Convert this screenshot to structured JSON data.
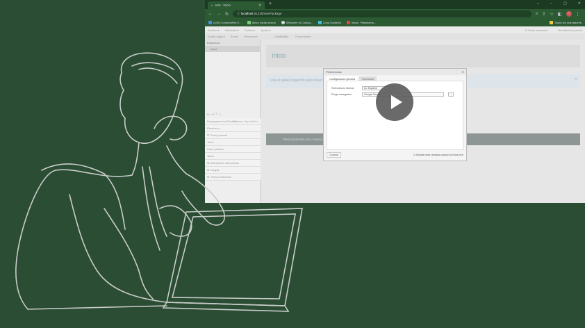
{
  "browser": {
    "tab_title": "eXe : Inicio",
    "url_host": "localhost",
    "url_path": ":51235/newPackage",
    "bookmarks": [
      "(429) ConnectWeb E...",
      "Alexa iniciar sesión",
      "Welcome to Coding...",
      "Zona Garantía",
      "Inicio | Plataforma..."
    ],
    "all_bookmarks": "Todos los marcadores",
    "avatar_letter": "C"
  },
  "app": {
    "menu": [
      "Archivo ▾",
      "Utilidades ▾",
      "Estilos ▾",
      "Ayuda ▾"
    ],
    "advanced_mode": "☑ Modo avanzado",
    "preview": "Visualización previa",
    "toolbar": [
      "Añadir página",
      "Borrar",
      "Renombrar"
    ],
    "content_tabs": [
      "Contenido",
      "Propiedades"
    ],
    "structure_label": "Estructura",
    "structure_node": "Inicio",
    "idevice_actions": [
      "Desagrupar los iDevices",
      "iDevices disponibles"
    ],
    "idevices_label": "iDevices ▴",
    "idevice_list": [
      "⊟ Texto y tareas",
      "Texto",
      "Caso práctico",
      "Tarea",
      "⊞ Actividades interactivas",
      "⊞ Juegos",
      "⊞ Otros contenidos"
    ],
    "page_title": "Inicio",
    "hint": "Use el panel izquierdo para crear la estructura...",
    "footer": "Obra publicada con Licencia..."
  },
  "dialog": {
    "title": "Preferencias",
    "tabs": [
      "Configuración general",
      "Avanzado"
    ],
    "language_label": "Seleccionar idioma:",
    "language_value": "es: Español",
    "browser_label": "Elegir navegador:",
    "browser_value": "Google Chrome",
    "browse_button": "...",
    "save_button": "Guardar",
    "show_on_start": "Mostrar esta ventana cuando se inicia eXe"
  }
}
